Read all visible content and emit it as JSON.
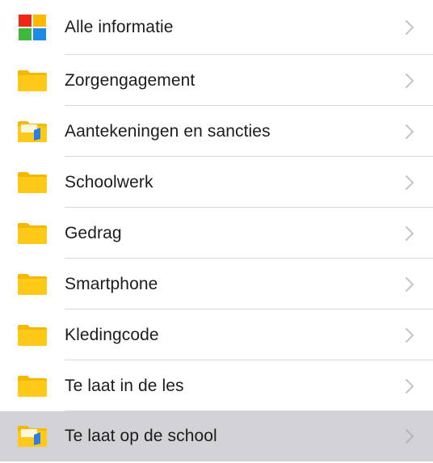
{
  "items": [
    {
      "label": "Alle informatie",
      "icon": "color-grid-icon"
    },
    {
      "label": "Zorgengagement",
      "icon": "folder-icon"
    },
    {
      "label": "Aantekeningen en sancties",
      "icon": "shared-folder-icon"
    },
    {
      "label": "Schoolwerk",
      "icon": "folder-icon"
    },
    {
      "label": "Gedrag",
      "icon": "folder-icon"
    },
    {
      "label": "Smartphone",
      "icon": "folder-icon"
    },
    {
      "label": "Kledingcode",
      "icon": "folder-icon"
    },
    {
      "label": "Te laat in de les",
      "icon": "folder-icon"
    },
    {
      "label": "Te laat op de school",
      "icon": "shared-folder-icon",
      "selected": true
    }
  ],
  "colors": {
    "folder": "#FFC91A",
    "folder_back": "#F5B800",
    "shared_badge": "#2F7FE0",
    "selected_row": "#D3D3D7",
    "grid_red": "#F0261B",
    "grid_yellow": "#FFB900",
    "grid_green": "#3EB93D",
    "grid_blue": "#1E8AE5"
  }
}
